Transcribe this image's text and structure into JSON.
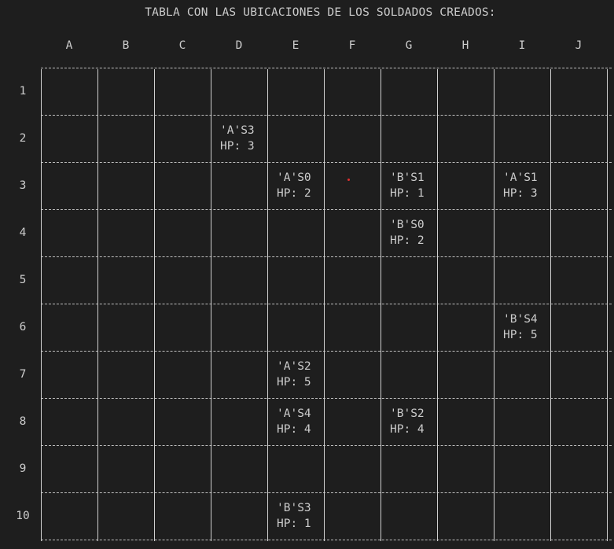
{
  "title": "TABLA CON LAS UBICACIONES DE LOS SOLDADOS CREADOS:",
  "columns": [
    "A",
    "B",
    "C",
    "D",
    "E",
    "F",
    "G",
    "H",
    "I",
    "J"
  ],
  "rows": [
    "1",
    "2",
    "3",
    "4",
    "5",
    "6",
    "7",
    "8",
    "9",
    "10"
  ],
  "soldiers": [
    {
      "id": "'A'S3",
      "hp_label": "HP: 3",
      "col": "D",
      "row": "2"
    },
    {
      "id": "'A'S0",
      "hp_label": "HP: 2",
      "col": "E",
      "row": "3"
    },
    {
      "id": "'B'S1",
      "hp_label": "HP: 1",
      "col": "G",
      "row": "3"
    },
    {
      "id": "'A'S1",
      "hp_label": "HP: 3",
      "col": "I",
      "row": "3"
    },
    {
      "id": "'B'S0",
      "hp_label": "HP: 2",
      "col": "G",
      "row": "4"
    },
    {
      "id": "'B'S4",
      "hp_label": "HP: 5",
      "col": "I",
      "row": "6"
    },
    {
      "id": "'A'S2",
      "hp_label": "HP: 5",
      "col": "E",
      "row": "7"
    },
    {
      "id": "'A'S4",
      "hp_label": "HP: 4",
      "col": "E",
      "row": "8"
    },
    {
      "id": "'B'S2",
      "hp_label": "HP: 4",
      "col": "G",
      "row": "8"
    },
    {
      "id": "'B'S3",
      "hp_label": "HP: 1",
      "col": "E",
      "row": "10"
    }
  ],
  "colors": {
    "background": "#1e1e1e",
    "text": "#cccccc",
    "grid": "#cfcfcf",
    "marker": "#e03030"
  }
}
